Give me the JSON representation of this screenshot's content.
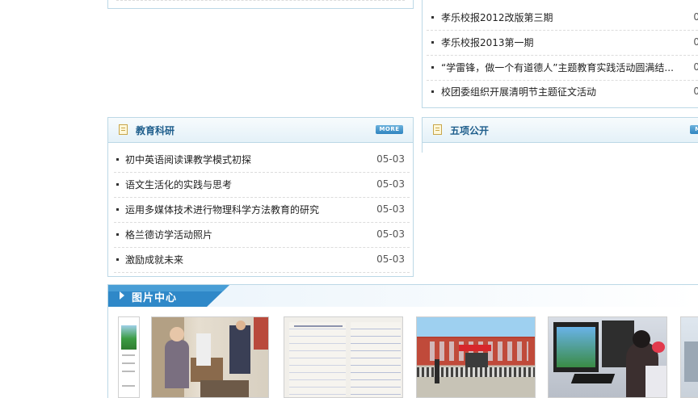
{
  "top_right_list": [
    {
      "title": "孝乐校报2012改版第三期",
      "date": "0"
    },
    {
      "title": "孝乐校报2013第一期",
      "date": "0"
    },
    {
      "title": "“学雷锋，做一个有道德人”主题教育实践活动圆满结...",
      "date": "0"
    },
    {
      "title": "校团委组织开展清明节主题征文活动",
      "date": "0"
    }
  ],
  "research": {
    "title": "教育科研",
    "more": "MORE",
    "items": [
      {
        "title": "初中英语阅读课教学模式初探",
        "date": "05-03"
      },
      {
        "title": "语文生活化的实践与思考",
        "date": "05-03"
      },
      {
        "title": "运用多媒体技术进行物理科学方法教育的研究",
        "date": "05-03"
      },
      {
        "title": "格兰德访学活动照片",
        "date": "05-03"
      },
      {
        "title": "激励成就未来",
        "date": "05-03"
      }
    ]
  },
  "five_public": {
    "title": "五项公开",
    "more": "M"
  },
  "gallery": {
    "title": "图片中心",
    "items": [
      {
        "name": "newspaper-thumbnail"
      },
      {
        "name": "elderly-visit-photo"
      },
      {
        "name": "handwritten-essay-photo"
      },
      {
        "name": "school-assembly-photo"
      },
      {
        "name": "computer-class-photo"
      },
      {
        "name": "partial-photo"
      }
    ]
  },
  "colors": {
    "border": "#bcd8e6",
    "title_blue": "#1e5e8c",
    "gallery_header": "#2f88c8"
  }
}
